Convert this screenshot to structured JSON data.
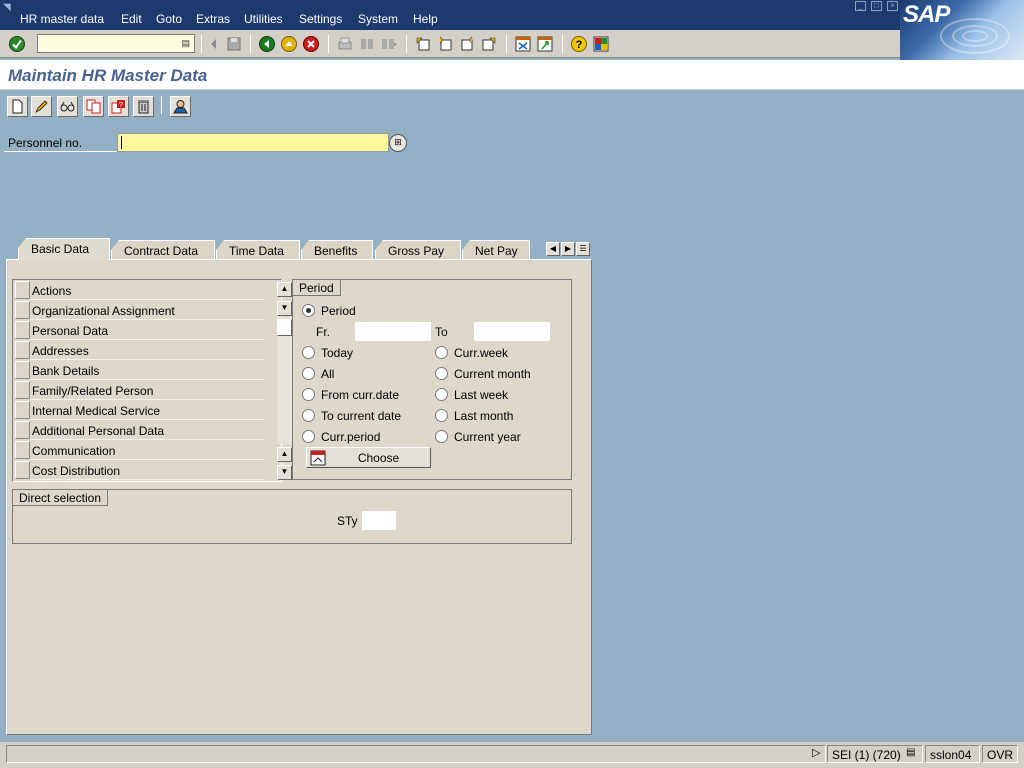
{
  "menubar": {
    "items": [
      "HR master data",
      "Edit",
      "Goto",
      "Extras",
      "Utilities",
      "Settings",
      "System",
      "Help"
    ],
    "logo": "SAP"
  },
  "toolbar": {
    "command_value": "",
    "icons": [
      "enter-icon",
      "back-icon",
      "exit-icon",
      "cancel-icon",
      "print-icon",
      "find-icon",
      "find-next-icon",
      "first-page-icon",
      "previous-page-icon",
      "next-page-icon",
      "last-page-icon",
      "create-session-icon",
      "shortcut-icon",
      "help-icon",
      "layout-menu-icon"
    ]
  },
  "title": "Maintain HR Master Data",
  "app_toolbar": {
    "icons": [
      "create-icon",
      "change-icon",
      "display-icon",
      "copy-icon",
      "overview-icon",
      "delete-icon",
      "employee-icon"
    ]
  },
  "personnel": {
    "label": "Personnel no.",
    "value": ""
  },
  "tabs": [
    {
      "label": "Basic Data",
      "active": true
    },
    {
      "label": "Contract Data",
      "active": false
    },
    {
      "label": "Time Data",
      "active": false
    },
    {
      "label": "Benefits",
      "active": false
    },
    {
      "label": "Gross Pay",
      "active": false
    },
    {
      "label": "Net Pay",
      "active": false
    }
  ],
  "infotypes": [
    "Actions",
    "Organizational Assignment",
    "Personal Data",
    "Addresses",
    "Bank Details",
    "Family/Related Person",
    "Internal Medical Service",
    "Additional Personal Data",
    "Communication",
    "Cost Distribution"
  ],
  "period": {
    "title": "Period",
    "options": {
      "period": "Period",
      "today": "Today",
      "all": "All",
      "from_curr_date": "From curr.date",
      "to_current_date": "To current date",
      "curr_period": "Curr.period",
      "curr_week": "Curr.week",
      "current_month": "Current month",
      "last_week": "Last week",
      "last_month": "Last month",
      "current_year": "Current year"
    },
    "selected": "period",
    "from_label": "Fr.",
    "to_label": "To",
    "from_value": "",
    "to_value": "",
    "choose_label": "Choose"
  },
  "direct": {
    "title": "Direct selection",
    "sty_label": "STy",
    "sty_value": ""
  },
  "status": {
    "message": "",
    "session": "SEI (1) (720)",
    "server": "sslon04",
    "mode": "OVR"
  }
}
